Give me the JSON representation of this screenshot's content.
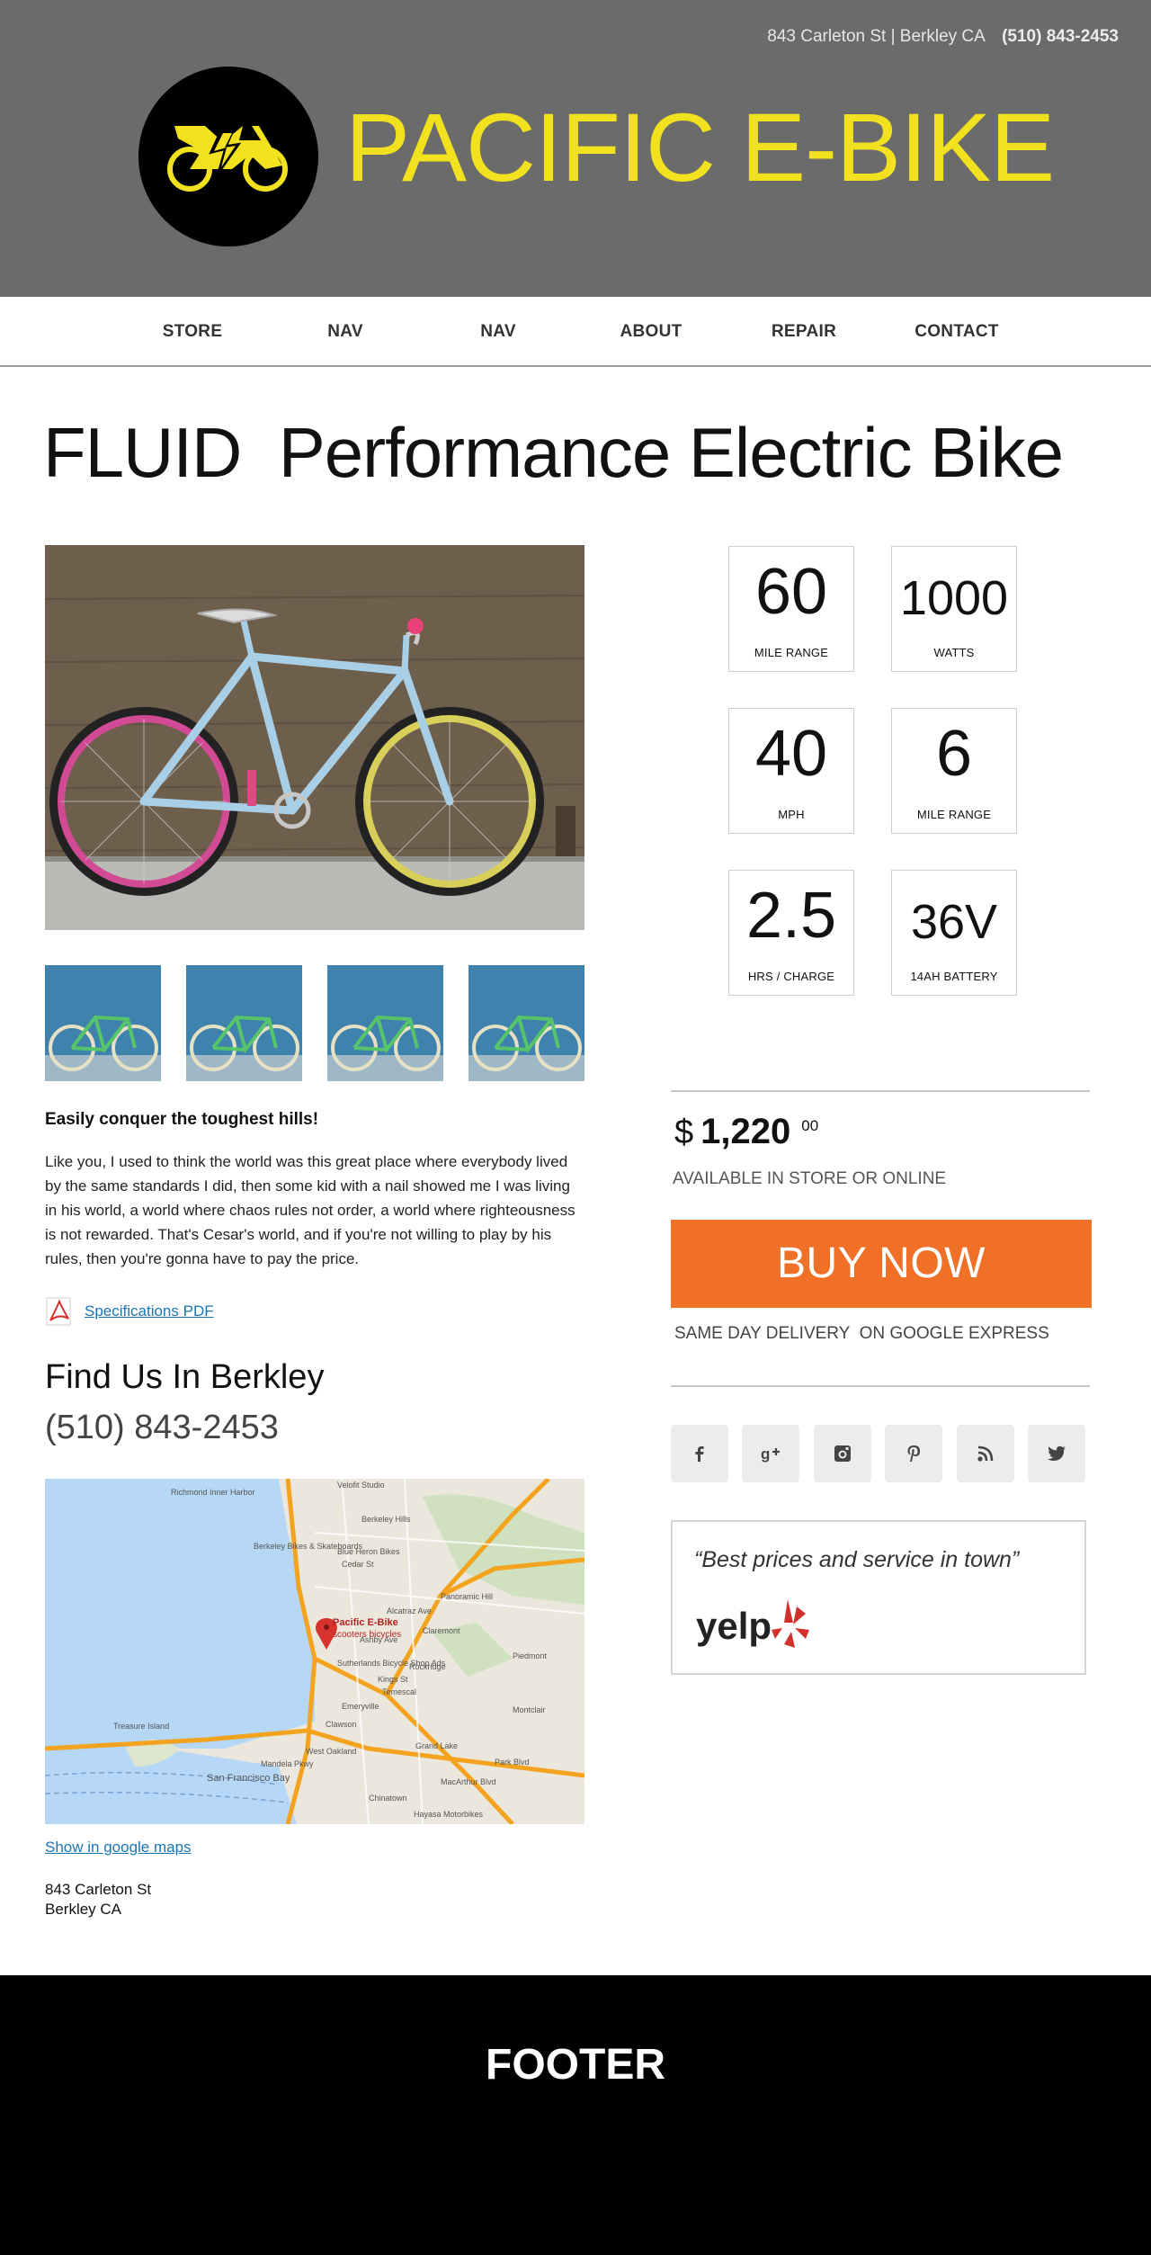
{
  "header": {
    "address": "843 Carleton St | Berkley CA",
    "phone": "(510) 843-2453",
    "brand": "PACIFIC E-BIKE",
    "brand_color": "#F2E11F",
    "logo_icon": "electric-bike-icon"
  },
  "nav": {
    "items": [
      {
        "label": "STORE"
      },
      {
        "label": "NAV"
      },
      {
        "label": "NAV"
      },
      {
        "label": "ABOUT"
      },
      {
        "label": "REPAIR"
      },
      {
        "label": "CONTACT"
      }
    ]
  },
  "product": {
    "title": "FLUID  Performance Electric Bike",
    "tagline": "Easily conquer the toughest hills!",
    "description": "Like you, I used to think the world was this great place where everybody lived by the same standards I did, then some kid with a nail showed me I was living in his world, a world where chaos rules not order, a world where righteousness is not rewarded. That's Cesar's world, and if you're not willing to play by his rules, then you're gonna have to pay the price.",
    "pdf_label": "Specifications PDF",
    "thumbnail_count": 4
  },
  "specs": [
    {
      "value": "60",
      "label": "MILE RANGE"
    },
    {
      "value": "1000",
      "label": "WATTS"
    },
    {
      "value": "40",
      "label": "MPH"
    },
    {
      "value": "6",
      "label": "MILE RANGE"
    },
    {
      "value": "2.5",
      "label": "HRS / CHARGE"
    },
    {
      "value": "36V",
      "label": "14AH BATTERY"
    }
  ],
  "purchase": {
    "currency": "$",
    "price": "1,220",
    "cents": "00",
    "availability": "AVAILABLE IN STORE OR ONLINE",
    "buy_label": "BUY NOW",
    "buy_color": "#F07028",
    "delivery": "SAME DAY DELIVERY  ON GOOGLE EXPRESS"
  },
  "social": [
    "facebook-icon",
    "google-plus-icon",
    "instagram-icon",
    "pinterest-icon",
    "rss-icon",
    "twitter-icon"
  ],
  "review": {
    "quote": "“Best prices and service in town”",
    "source": "yelp"
  },
  "location": {
    "title": "Find Us In Berkley",
    "phone": "(510) 843-2453",
    "map_link": "Show in google maps",
    "street": "843 Carleton St",
    "city": "Berkley CA",
    "map_labels": {
      "marker_name": "Pacific E-Bike",
      "marker_sub": "scooters  bicycles",
      "places": [
        "Richmond Inner Harbor",
        "Velofit Studio",
        "Berkeley Hills",
        "Berkeley Bikes & Skateboards",
        "Blue Heron Bikes",
        "Cedar St",
        "Panoramic Hill",
        "Claremont",
        "Sutherlands Bicycle Shop Ads",
        "Rockridge",
        "Temescal",
        "Emeryville",
        "Montclair",
        "Treasure Island",
        "Clawson",
        "West Oakland",
        "Grand Lake",
        "San Francisco Bay",
        "Chinatown",
        "Hayasa Motorbikes",
        "Park Blvd",
        "MacArthur Blvd",
        "Alcatraz Ave",
        "Ashby Ave",
        "Mandela Pkwy",
        "Kings St",
        "Piedmont"
      ]
    }
  },
  "footer": {
    "label": "FOOTER"
  }
}
